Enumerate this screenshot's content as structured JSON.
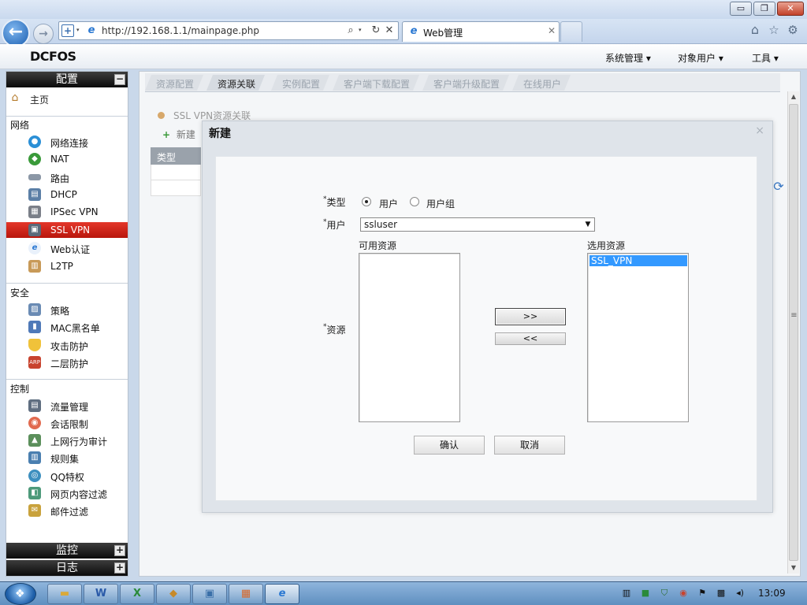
{
  "browser": {
    "address": "http://192.168.1.1/mainpage.php",
    "tab_title": "Web管理",
    "win_min": "▭",
    "win_max": "❐",
    "win_close": "✕"
  },
  "app": {
    "logo": "DCFOS",
    "top_menu": [
      "系统管理 ▾",
      "对象用户 ▾",
      "工具 ▾"
    ]
  },
  "sidebar": {
    "config_header": "配置",
    "home": "主页",
    "sections": {
      "network": "网络",
      "security": "安全",
      "control": "控制"
    },
    "network_items": [
      "网络连接",
      "NAT",
      "路由",
      "DHCP",
      "IPSec VPN",
      "SSL VPN",
      "Web认证",
      "L2TP"
    ],
    "security_items": [
      "策略",
      "MAC黑名单",
      "攻击防护",
      "二层防护"
    ],
    "control_items": [
      "流量管理",
      "会话限制",
      "上网行为审计",
      "规则集",
      "QQ特权",
      "网页内容过滤",
      "邮件过滤"
    ],
    "monitor_header": "监控",
    "log_header": "日志",
    "toggle_minus": "−",
    "toggle_plus": "+"
  },
  "page": {
    "tabs": [
      "资源配置",
      "资源关联",
      "实例配置",
      "客户端下载配置",
      "客户端升级配置",
      "在线用户"
    ],
    "active_tab": "资源关联",
    "panel_title": "SSL VPN资源关联",
    "new_label": "新建",
    "grid_header": "类型"
  },
  "dialog": {
    "title": "新建",
    "close": "×",
    "type_label": "类型",
    "type_options": [
      "用户",
      "用户组"
    ],
    "type_selected": "用户",
    "user_label": "用户",
    "user_value": "ssluser",
    "available_label": "可用资源",
    "selected_label": "选用资源",
    "available_items": [],
    "selected_items": [
      "SSL_VPN"
    ],
    "resource_label": "资源",
    "add_btn": ">>",
    "remove_btn": "<<",
    "confirm_btn": "确认",
    "cancel_btn": "取消",
    "required_mark": "*"
  },
  "taskbar": {
    "clock": "13:09"
  },
  "colors": {
    "active_nav": "#d1241a",
    "selection": "#3399ff"
  }
}
